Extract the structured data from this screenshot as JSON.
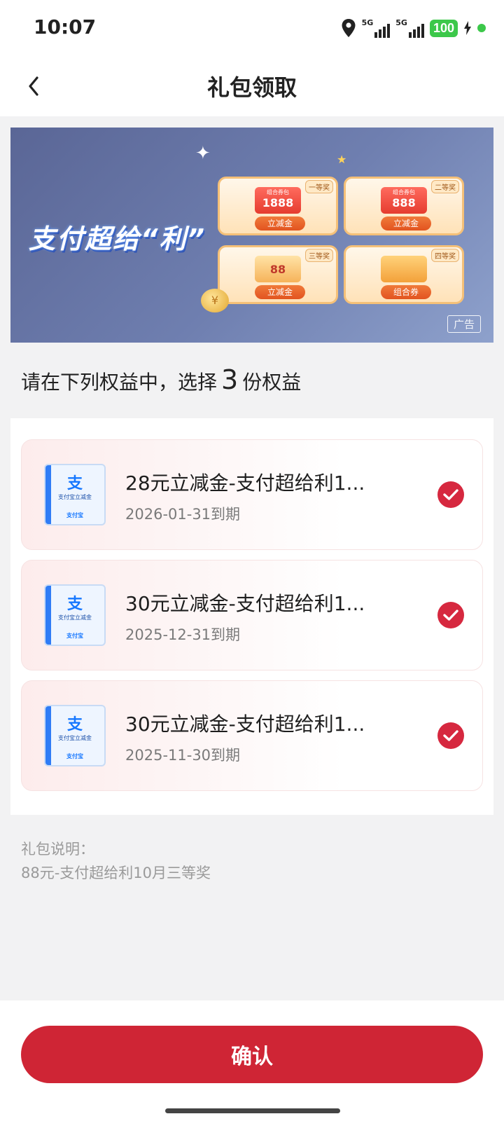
{
  "status_bar": {
    "time": "10:07",
    "network1": "5G",
    "network2": "5G",
    "battery": "100"
  },
  "header": {
    "title": "礼包领取"
  },
  "banner": {
    "slogan": "支付超给“利”",
    "prizes": [
      {
        "rank": "一等奖",
        "box_label": "组合券包",
        "box_value": "1888",
        "button": "立减金"
      },
      {
        "rank": "二等奖",
        "box_label": "组合券包",
        "box_value": "888",
        "button": "立减金"
      },
      {
        "rank": "三等奖",
        "box_label": "",
        "box_value": "88",
        "button": "立减金"
      },
      {
        "rank": "四等奖",
        "box_label": "",
        "box_value": "",
        "button": "组合券"
      }
    ],
    "ad_badge": "广告"
  },
  "instruction": {
    "prefix": "请在下列权益中，选择",
    "count": "3",
    "suffix": "份权益"
  },
  "rewards": [
    {
      "title": "28元立减金-支付超给利1...",
      "expiry": "2026-01-31到期",
      "thumb_label": "支付宝立减金",
      "thumb_logo": "支付宝",
      "selected": true
    },
    {
      "title": "30元立减金-支付超给利1...",
      "expiry": "2025-12-31到期",
      "thumb_label": "支付宝立减金",
      "thumb_logo": "支付宝",
      "selected": true
    },
    {
      "title": "30元立减金-支付超给利1...",
      "expiry": "2025-11-30到期",
      "thumb_label": "支付宝立减金",
      "thumb_logo": "支付宝",
      "selected": true
    }
  ],
  "description": {
    "label": "礼包说明：",
    "text": "88元-支付超给利10月三等奖"
  },
  "footer": {
    "confirm_label": "确认"
  },
  "colors": {
    "accent": "#cf2535",
    "check": "#d6283f",
    "banner_bg": "#6573a6"
  }
}
